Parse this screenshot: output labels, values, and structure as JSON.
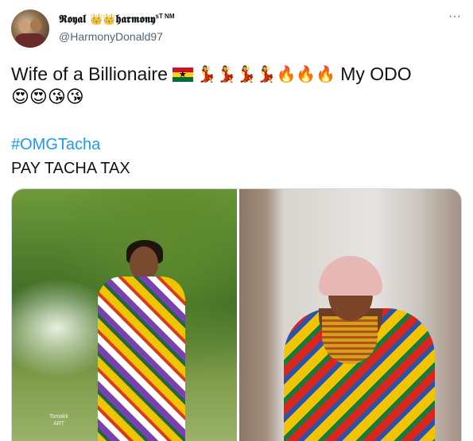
{
  "user": {
    "display_name_prefix": "𝕽𝖔𝖞𝖆𝖑",
    "crown": "👑👑",
    "display_name_suffix": "𝖍𝖆𝖗𝖒𝖔𝖓𝖞",
    "superscript": "sT NM",
    "handle": "@HarmonyDonald97"
  },
  "more_icon": "···",
  "tweet": {
    "line1_text": "Wife of a Billionaire",
    "flag_label": "★",
    "line1_emojis": "💃💃💃💃🔥🔥🔥",
    "line1_tail": "My ODO",
    "line2_emojis": "😍😍😘😘",
    "hashtag": "#OMGTacha",
    "text2": "PAY TACHA TAX"
  },
  "media": {
    "watermark": "Tomakk ART"
  }
}
